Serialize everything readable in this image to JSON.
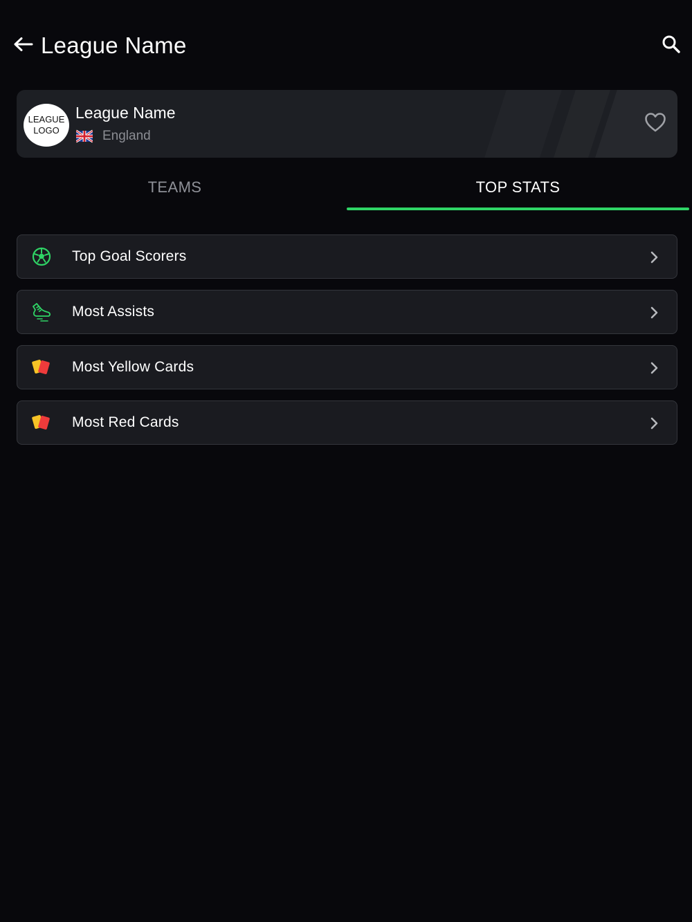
{
  "app_bar": {
    "title": "League Name",
    "back_icon": "arrow-left-icon",
    "search_icon": "search-icon"
  },
  "league": {
    "logo_line1": "LEAGUE",
    "logo_line2": "LOGO",
    "name": "League Name",
    "country": "England",
    "flag_icon": "uk-flag-icon",
    "favorite_icon": "heart-outline-icon"
  },
  "tabs": [
    {
      "label": "TEAMS",
      "active": false
    },
    {
      "label": "TOP STATS",
      "active": true
    }
  ],
  "stats": [
    {
      "label": "Top Goal Scorers",
      "icon": "soccer-ball-icon"
    },
    {
      "label": "Most Assists",
      "icon": "boot-icon"
    },
    {
      "label": "Most Yellow Cards",
      "icon": "yellow-card-icon"
    },
    {
      "label": "Most Red Cards",
      "icon": "red-card-icon"
    }
  ],
  "colors": {
    "background": "#08080c",
    "accent": "#2fd566",
    "card": "#1a1b20",
    "muted_text": "#8e9097",
    "yellow_card": "#f7c326",
    "red_card": "#ee3b3b"
  }
}
